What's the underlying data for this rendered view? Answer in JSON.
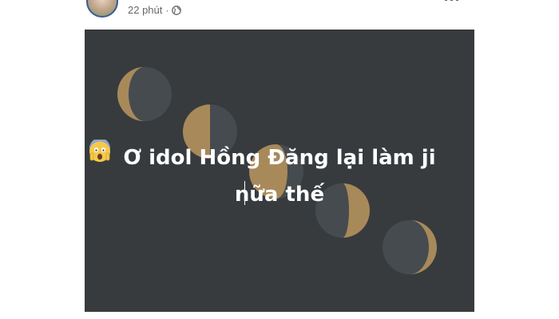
{
  "post": {
    "time_ago": "22 phút",
    "separator": "·",
    "privacy_icon": "globe-icon",
    "more_icon": "more-options-icon"
  },
  "image": {
    "background_color": "#373b3e",
    "moon_color": "#a8895a",
    "shadow_color": "#464b4f",
    "caption_line1": "Ơ idol Hồng Đăng lại làm ji",
    "caption_line2": "nữa thế",
    "caption_emoji": "face-screaming-in-fear-emoji"
  }
}
